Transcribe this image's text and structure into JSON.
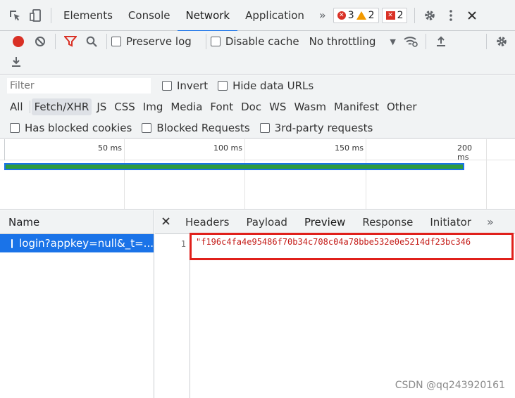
{
  "topbar": {
    "tabs": [
      {
        "label": "Elements"
      },
      {
        "label": "Console"
      },
      {
        "label": "Network"
      },
      {
        "label": "Application"
      }
    ],
    "errors": "3",
    "warnings": "2",
    "issues": "2"
  },
  "toolbar": {
    "preserve_log": "Preserve log",
    "disable_cache": "Disable cache",
    "throttling": "No throttling"
  },
  "filter": {
    "placeholder": "Filter",
    "invert": "Invert",
    "hide_data_urls": "Hide data URLs"
  },
  "types": [
    "All",
    "Fetch/XHR",
    "JS",
    "CSS",
    "Img",
    "Media",
    "Font",
    "Doc",
    "WS",
    "Wasm",
    "Manifest",
    "Other"
  ],
  "blocked": {
    "has_blocked_cookies": "Has blocked cookies",
    "blocked_requests": "Blocked Requests",
    "third_party": "3rd-party requests"
  },
  "overview": {
    "ticks": [
      "50 ms",
      "100 ms",
      "150 ms",
      "200 ms"
    ]
  },
  "requests": {
    "header": "Name",
    "items": [
      {
        "name": "login?appkey=null&_t=..."
      }
    ]
  },
  "detail": {
    "tabs": [
      "Headers",
      "Payload",
      "Preview",
      "Response",
      "Initiator"
    ],
    "line_number": "1",
    "response_text": "\"f196c4fa4e95486f70b34c708c04a78bbe532e0e5214df23bc346"
  },
  "watermark": "CSDN @qq243920161",
  "colors": {
    "accent": "#1a73e8",
    "error": "#d93025",
    "warning": "#f29900",
    "highlight": "#e0201b"
  }
}
